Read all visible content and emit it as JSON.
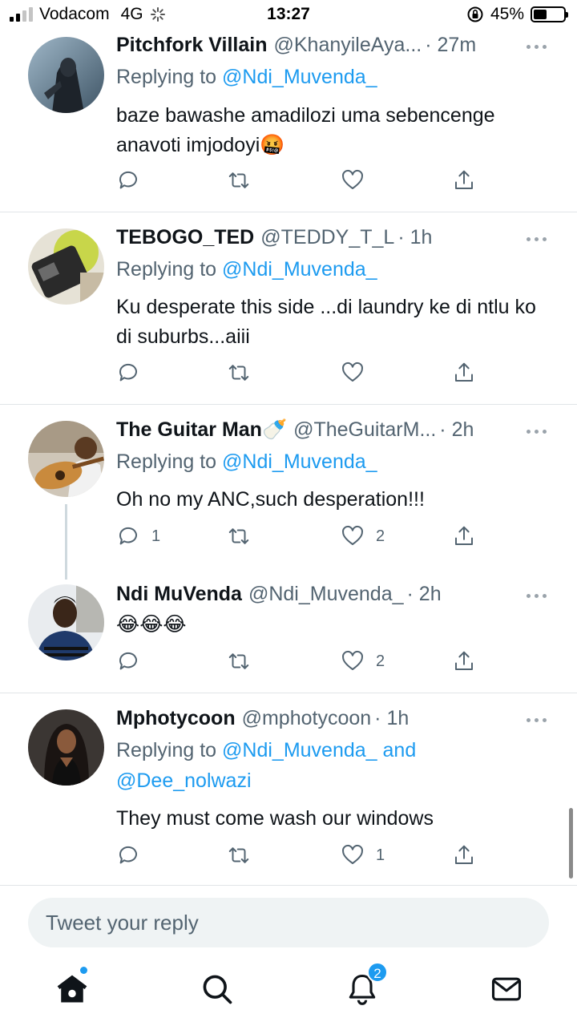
{
  "status_bar": {
    "carrier": "Vodacom",
    "network": "4G",
    "time": "13:27",
    "battery": "45%",
    "battery_level": 0.45
  },
  "tweets": [
    {
      "name": "Pitchfork Villain",
      "handle": "@KhanyileAya...",
      "time": "· 27m",
      "replying_prefix": "Replying to ",
      "replying_to": "@Ndi_Muvenda_",
      "text": "baze bawashe amadilozi uma sebencenge anavoti imjodoyi🤬",
      "replies": "",
      "likes": ""
    },
    {
      "name": "TEBOGO_TED",
      "handle": "@TEDDY_T_L",
      "time": "· 1h",
      "replying_prefix": "Replying to ",
      "replying_to": "@Ndi_Muvenda_",
      "text": "Ku desperate this side ...di laundry ke di ntlu ko di suburbs...aiii",
      "replies": "",
      "likes": ""
    },
    {
      "name": "The Guitar Man🍼",
      "handle": "@TheGuitarM...",
      "time": "· 2h",
      "replying_prefix": "Replying to ",
      "replying_to": "@Ndi_Muvenda_",
      "text": "Oh no my ANC,such desperation!!!",
      "replies": "1",
      "likes": "2"
    },
    {
      "name": "Ndi MuVenda",
      "handle": "@Ndi_Muvenda_",
      "time": "· 2h",
      "text": "😂😂😂",
      "replies": "",
      "likes": "2"
    },
    {
      "name": "Mphotycoon",
      "handle": "@mphotycoon",
      "time": "· 1h",
      "replying_prefix": "Replying to ",
      "replying_to": "@Ndi_Muvenda_ and",
      "replying_to_2": "@Dee_nolwazi",
      "text": "They must come wash our windows",
      "replies": "",
      "likes": "1"
    }
  ],
  "reply_box": {
    "placeholder": "Tweet your reply"
  },
  "nav": {
    "notifications_badge": "2"
  },
  "colors": {
    "accent": "#1d9bf0",
    "secondary_text": "#536471",
    "divider": "#e1e5e8"
  }
}
